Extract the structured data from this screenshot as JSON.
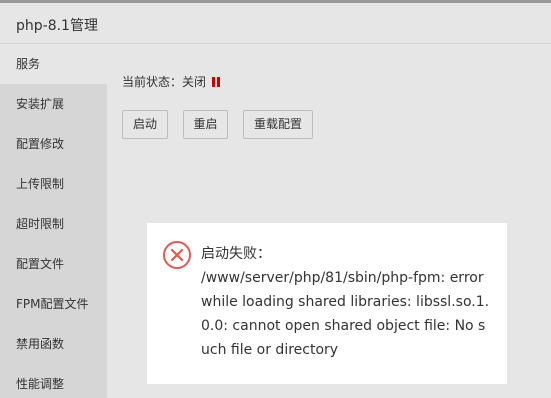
{
  "window": {
    "title": "php-8.1管理"
  },
  "sidebar": {
    "items": [
      {
        "label": "服务"
      },
      {
        "label": "安装扩展"
      },
      {
        "label": "配置修改"
      },
      {
        "label": "上传限制"
      },
      {
        "label": "超时限制"
      },
      {
        "label": "配置文件"
      },
      {
        "label": "FPM配置文件"
      },
      {
        "label": "禁用函数"
      },
      {
        "label": "性能调整"
      }
    ]
  },
  "service": {
    "status_label": "当前状态：",
    "status_value": "关闭",
    "status_color": "#d00000",
    "buttons": {
      "start": "启动",
      "restart": "重启",
      "reload": "重载配置"
    }
  },
  "error_dialog": {
    "icon": "error-circle-x-icon",
    "icon_color": "#e05a4f",
    "title": "启动失败：",
    "message": "/www/server/php/81/sbin/php-fpm: error while loading shared libraries: libssl.so.1.0.0: cannot open shared object file: No such file or directory"
  }
}
